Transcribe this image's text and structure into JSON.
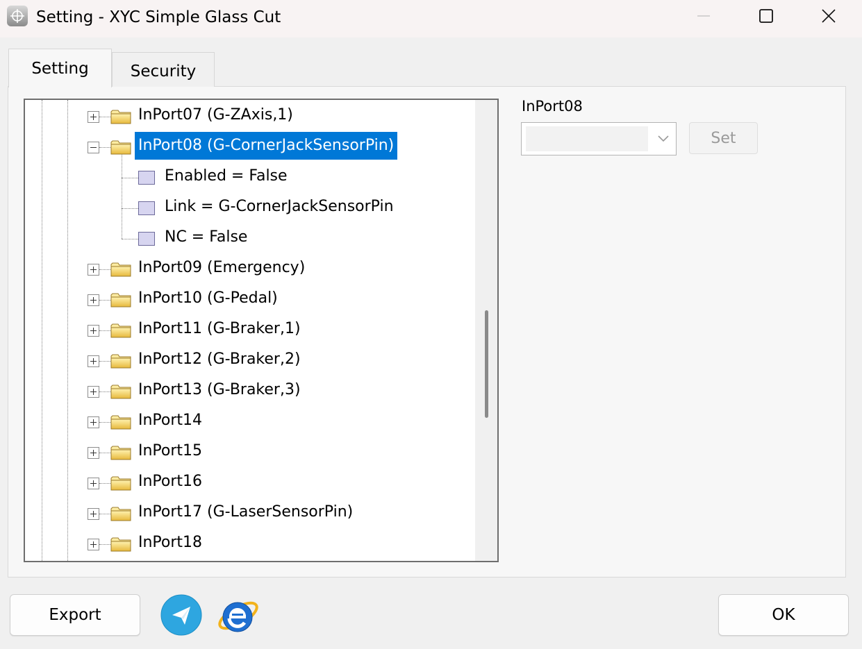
{
  "window": {
    "title": "Setting - XYC Simple Glass Cut",
    "icon": "crosshair-icon",
    "controls": {
      "minimize": "minimize-icon",
      "maximize": "maximize-icon",
      "close": "close-icon"
    }
  },
  "tabs": [
    {
      "label": "Setting",
      "active": true
    },
    {
      "label": "Security",
      "active": false
    }
  ],
  "tree": {
    "items": [
      {
        "label": "InPort07 (G-ZAxis,1)",
        "expanded": false
      },
      {
        "label": "InPort08 (G-CornerJackSensorPin)",
        "expanded": true,
        "selected": true,
        "children": [
          "Enabled = False",
          "Link = G-CornerJackSensorPin",
          "NC = False"
        ]
      },
      {
        "label": "InPort09 (Emergency)",
        "expanded": false
      },
      {
        "label": "InPort10 (G-Pedal)",
        "expanded": false
      },
      {
        "label": "InPort11 (G-Braker,1)",
        "expanded": false
      },
      {
        "label": "InPort12 (G-Braker,2)",
        "expanded": false
      },
      {
        "label": "InPort13 (G-Braker,3)",
        "expanded": false
      },
      {
        "label": "InPort14",
        "expanded": false
      },
      {
        "label": "InPort15",
        "expanded": false
      },
      {
        "label": "InPort16",
        "expanded": false
      },
      {
        "label": "InPort17 (G-LaserSensorPin)",
        "expanded": false
      },
      {
        "label": "InPort18",
        "expanded": false
      }
    ]
  },
  "editor": {
    "label": "InPort08",
    "value": "",
    "set_label": "Set"
  },
  "footer": {
    "export_label": "Export",
    "ok_label": "OK",
    "icons": [
      "telegram-icon",
      "internet-explorer-icon"
    ]
  },
  "colors": {
    "selection": "#0078d7",
    "telegram": "#2ea6e0",
    "ie": "#1f6fd1"
  }
}
